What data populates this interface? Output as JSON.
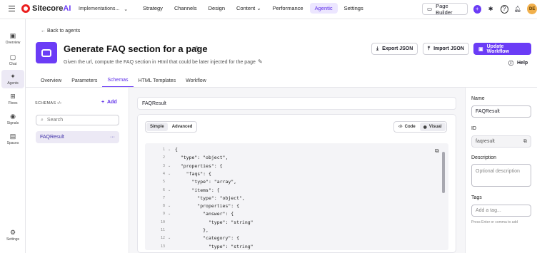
{
  "topbar": {
    "brand_prefix": "Sitecore",
    "brand_suffix": "AI",
    "workspace": "Implementations...",
    "nav": [
      "Strategy",
      "Channels",
      "Design",
      "Content",
      "Performance",
      "Agentic",
      "Settings"
    ],
    "active_nav": "Agentic",
    "page_builder": "Page Builder",
    "avatar": "DE"
  },
  "rail": [
    {
      "icon": "overview-icon",
      "label": "Overview"
    },
    {
      "icon": "chat-icon",
      "label": "Chat"
    },
    {
      "icon": "agents-icon",
      "label": "Agents"
    },
    {
      "icon": "flows-icon",
      "label": "Flows"
    },
    {
      "icon": "signals-icon",
      "label": "Signals"
    },
    {
      "icon": "spaces-icon",
      "label": "Spaces"
    },
    {
      "icon": "settings-icon",
      "label": "Settings"
    }
  ],
  "header": {
    "back": "Back to agents",
    "title": "Generate FAQ section for a page",
    "description": "Given the url, compute the FAQ section in Html that could be later injected for the page",
    "export": "Export JSON",
    "import": "Import JSON",
    "update": "Update Workflow",
    "help": "Help"
  },
  "tabs": [
    "Overview",
    "Parameters",
    "Schemas",
    "HTML Templates",
    "Workflow"
  ],
  "active_tab": "Schemas",
  "schemas": {
    "heading": "SCHEMAS",
    "add": "Add",
    "search_placeholder": "Search",
    "selected": "FAQResult"
  },
  "editor": {
    "name": "FAQResult",
    "mode_simple": "Simple",
    "mode_advanced": "Advanced",
    "view_code": "Code",
    "view_visual": "Visual",
    "lines": [
      {
        "n": "1",
        "t": "{",
        "f": true
      },
      {
        "n": "2",
        "t": "  \"type\": \"object\",",
        "f": false
      },
      {
        "n": "3",
        "t": "  \"properties\": {",
        "f": true
      },
      {
        "n": "4",
        "t": "    \"faqs\": {",
        "f": true
      },
      {
        "n": "5",
        "t": "      \"type\": \"array\",",
        "f": false
      },
      {
        "n": "6",
        "t": "      \"items\": {",
        "f": true
      },
      {
        "n": "7",
        "t": "        \"type\": \"object\",",
        "f": false
      },
      {
        "n": "8",
        "t": "        \"properties\": {",
        "f": true
      },
      {
        "n": "9",
        "t": "          \"answer\": {",
        "f": true
      },
      {
        "n": "10",
        "t": "            \"type\": \"string\"",
        "f": false
      },
      {
        "n": "11",
        "t": "          },",
        "f": false
      },
      {
        "n": "12",
        "t": "          \"category\": {",
        "f": true
      },
      {
        "n": "13",
        "t": "            \"type\": \"string\"",
        "f": false
      }
    ]
  },
  "panel": {
    "name_label": "Name",
    "name_value": "FAQResult",
    "id_label": "ID",
    "id_value": "faqresult",
    "description_label": "Description",
    "description_placeholder": "Optional description",
    "tags_label": "Tags",
    "tags_placeholder": "Add a tag...",
    "tags_hint": "Press Enter or comma to add"
  },
  "colors": {
    "accent": "#6b3cf6",
    "brand_red": "#eb1f1f"
  }
}
